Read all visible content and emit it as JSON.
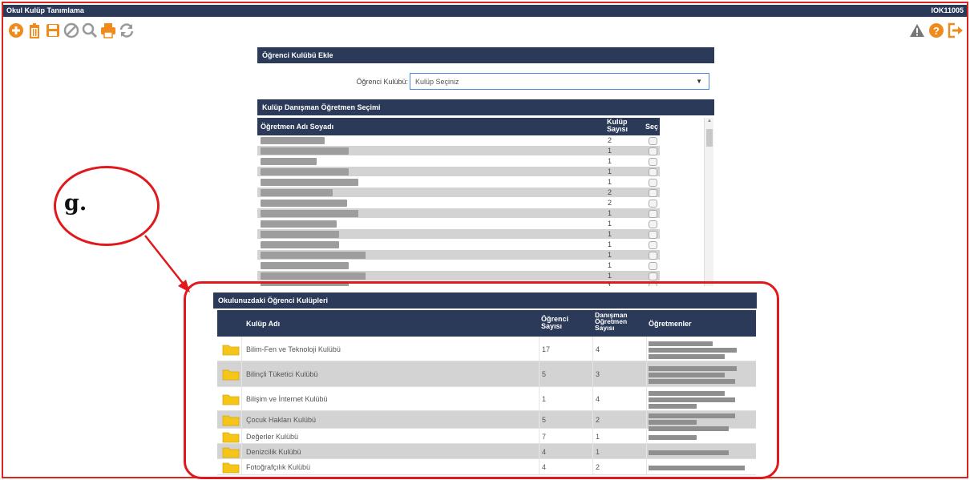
{
  "window": {
    "title": "Okul Kulüp Tanımlama",
    "code": "IOK11005"
  },
  "toolbar": {
    "left_icons": [
      "add-icon",
      "delete-icon",
      "save-icon",
      "cancel-icon",
      "search-icon",
      "print-icon",
      "refresh-icon"
    ],
    "right_icons": [
      "warning-icon",
      "help-icon",
      "exit-icon"
    ]
  },
  "colors": {
    "header": "#2c3a5a",
    "accent_red": "#e0191d",
    "folder": "#f5c518"
  },
  "ogrenci_kulubu_ekle": {
    "title": "Öğrenci Kulübü Ekle",
    "label": "Öğrenci Kulübü",
    "select_value": "Kulüp Seçiniz"
  },
  "danisman_secimi": {
    "title": "Kulüp Danışman Öğretmen Seçimi",
    "headers": {
      "name": "Öğretmen Adı Soyadı",
      "count": "Kulüp Sayısı",
      "select": "Seç"
    },
    "rows": [
      {
        "count": "2"
      },
      {
        "count": "1"
      },
      {
        "count": "1"
      },
      {
        "count": "1"
      },
      {
        "count": "1"
      },
      {
        "count": "2"
      },
      {
        "count": "2"
      },
      {
        "count": "1"
      },
      {
        "count": "1"
      },
      {
        "count": "1"
      },
      {
        "count": "1"
      },
      {
        "count": "1"
      },
      {
        "count": "1"
      },
      {
        "count": "1"
      },
      {
        "count": "1"
      }
    ]
  },
  "kulupler": {
    "title": "Okulunuzdaki Öğrenci Kulüpleri",
    "headers": {
      "name": "Kulüp Adı",
      "students": "Öğrenci Sayısı",
      "advisors": "Danışman Öğretmen Sayısı",
      "teachers": "Öğretmenler"
    },
    "rows": [
      {
        "name": "Bilim-Fen ve Teknoloji Kulübü",
        "students": "17",
        "advisors": "4"
      },
      {
        "name": "Bilinçli Tüketici Kulübü",
        "students": "5",
        "advisors": "3"
      },
      {
        "name": "Bilişim ve İnternet Kulübü",
        "students": "1",
        "advisors": "4"
      },
      {
        "name": "Çocuk Hakları Kulübü",
        "students": "5",
        "advisors": "2"
      },
      {
        "name": "Değerler Kulübü",
        "students": "7",
        "advisors": "1"
      },
      {
        "name": "Denizcilik Kulübü",
        "students": "4",
        "advisors": "1"
      },
      {
        "name": "Fotoğrafçılık Kulübü",
        "students": "4",
        "advisors": "2"
      }
    ]
  },
  "annotation": {
    "label": "g."
  }
}
